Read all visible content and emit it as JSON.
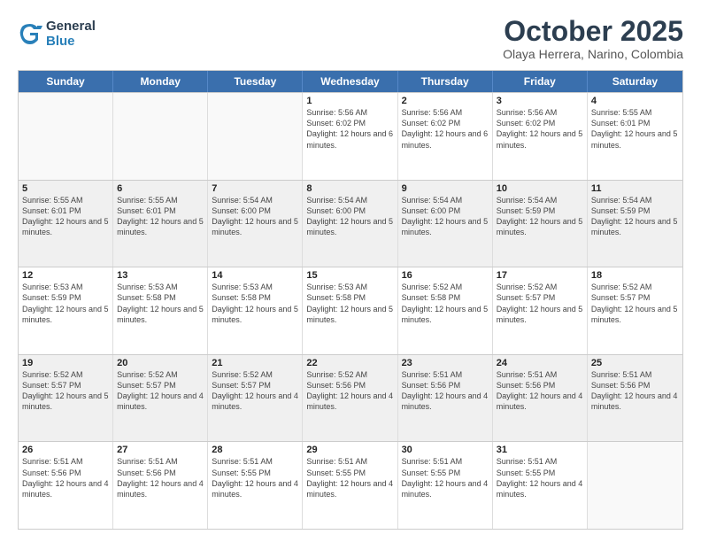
{
  "logo": {
    "general": "General",
    "blue": "Blue"
  },
  "title": "October 2025",
  "subtitle": "Olaya Herrera, Narino, Colombia",
  "weekdays": [
    "Sunday",
    "Monday",
    "Tuesday",
    "Wednesday",
    "Thursday",
    "Friday",
    "Saturday"
  ],
  "rows": [
    [
      {
        "day": "",
        "info": ""
      },
      {
        "day": "",
        "info": ""
      },
      {
        "day": "",
        "info": ""
      },
      {
        "day": "1",
        "info": "Sunrise: 5:56 AM\nSunset: 6:02 PM\nDaylight: 12 hours\nand 6 minutes."
      },
      {
        "day": "2",
        "info": "Sunrise: 5:56 AM\nSunset: 6:02 PM\nDaylight: 12 hours\nand 6 minutes."
      },
      {
        "day": "3",
        "info": "Sunrise: 5:56 AM\nSunset: 6:02 PM\nDaylight: 12 hours\nand 5 minutes."
      },
      {
        "day": "4",
        "info": "Sunrise: 5:55 AM\nSunset: 6:01 PM\nDaylight: 12 hours\nand 5 minutes."
      }
    ],
    [
      {
        "day": "5",
        "info": "Sunrise: 5:55 AM\nSunset: 6:01 PM\nDaylight: 12 hours\nand 5 minutes."
      },
      {
        "day": "6",
        "info": "Sunrise: 5:55 AM\nSunset: 6:01 PM\nDaylight: 12 hours\nand 5 minutes."
      },
      {
        "day": "7",
        "info": "Sunrise: 5:54 AM\nSunset: 6:00 PM\nDaylight: 12 hours\nand 5 minutes."
      },
      {
        "day": "8",
        "info": "Sunrise: 5:54 AM\nSunset: 6:00 PM\nDaylight: 12 hours\nand 5 minutes."
      },
      {
        "day": "9",
        "info": "Sunrise: 5:54 AM\nSunset: 6:00 PM\nDaylight: 12 hours\nand 5 minutes."
      },
      {
        "day": "10",
        "info": "Sunrise: 5:54 AM\nSunset: 5:59 PM\nDaylight: 12 hours\nand 5 minutes."
      },
      {
        "day": "11",
        "info": "Sunrise: 5:54 AM\nSunset: 5:59 PM\nDaylight: 12 hours\nand 5 minutes."
      }
    ],
    [
      {
        "day": "12",
        "info": "Sunrise: 5:53 AM\nSunset: 5:59 PM\nDaylight: 12 hours\nand 5 minutes."
      },
      {
        "day": "13",
        "info": "Sunrise: 5:53 AM\nSunset: 5:58 PM\nDaylight: 12 hours\nand 5 minutes."
      },
      {
        "day": "14",
        "info": "Sunrise: 5:53 AM\nSunset: 5:58 PM\nDaylight: 12 hours\nand 5 minutes."
      },
      {
        "day": "15",
        "info": "Sunrise: 5:53 AM\nSunset: 5:58 PM\nDaylight: 12 hours\nand 5 minutes."
      },
      {
        "day": "16",
        "info": "Sunrise: 5:52 AM\nSunset: 5:58 PM\nDaylight: 12 hours\nand 5 minutes."
      },
      {
        "day": "17",
        "info": "Sunrise: 5:52 AM\nSunset: 5:57 PM\nDaylight: 12 hours\nand 5 minutes."
      },
      {
        "day": "18",
        "info": "Sunrise: 5:52 AM\nSunset: 5:57 PM\nDaylight: 12 hours\nand 5 minutes."
      }
    ],
    [
      {
        "day": "19",
        "info": "Sunrise: 5:52 AM\nSunset: 5:57 PM\nDaylight: 12 hours\nand 5 minutes."
      },
      {
        "day": "20",
        "info": "Sunrise: 5:52 AM\nSunset: 5:57 PM\nDaylight: 12 hours\nand 4 minutes."
      },
      {
        "day": "21",
        "info": "Sunrise: 5:52 AM\nSunset: 5:57 PM\nDaylight: 12 hours\nand 4 minutes."
      },
      {
        "day": "22",
        "info": "Sunrise: 5:52 AM\nSunset: 5:56 PM\nDaylight: 12 hours\nand 4 minutes."
      },
      {
        "day": "23",
        "info": "Sunrise: 5:51 AM\nSunset: 5:56 PM\nDaylight: 12 hours\nand 4 minutes."
      },
      {
        "day": "24",
        "info": "Sunrise: 5:51 AM\nSunset: 5:56 PM\nDaylight: 12 hours\nand 4 minutes."
      },
      {
        "day": "25",
        "info": "Sunrise: 5:51 AM\nSunset: 5:56 PM\nDaylight: 12 hours\nand 4 minutes."
      }
    ],
    [
      {
        "day": "26",
        "info": "Sunrise: 5:51 AM\nSunset: 5:56 PM\nDaylight: 12 hours\nand 4 minutes."
      },
      {
        "day": "27",
        "info": "Sunrise: 5:51 AM\nSunset: 5:56 PM\nDaylight: 12 hours\nand 4 minutes."
      },
      {
        "day": "28",
        "info": "Sunrise: 5:51 AM\nSunset: 5:55 PM\nDaylight: 12 hours\nand 4 minutes."
      },
      {
        "day": "29",
        "info": "Sunrise: 5:51 AM\nSunset: 5:55 PM\nDaylight: 12 hours\nand 4 minutes."
      },
      {
        "day": "30",
        "info": "Sunrise: 5:51 AM\nSunset: 5:55 PM\nDaylight: 12 hours\nand 4 minutes."
      },
      {
        "day": "31",
        "info": "Sunrise: 5:51 AM\nSunset: 5:55 PM\nDaylight: 12 hours\nand 4 minutes."
      },
      {
        "day": "",
        "info": ""
      }
    ]
  ]
}
